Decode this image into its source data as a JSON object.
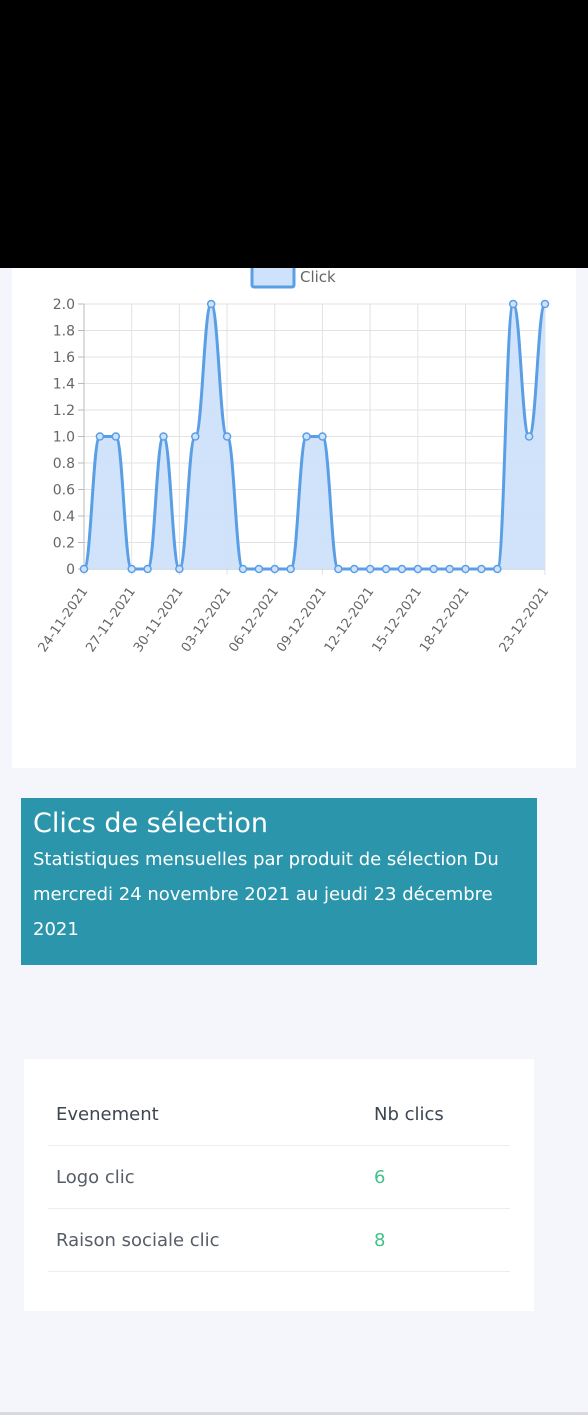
{
  "chart_data": {
    "type": "line",
    "legend": "Click",
    "x_tick_labels": [
      "24-11-2021",
      "27-11-2021",
      "30-11-2021",
      "03-12-2021",
      "06-12-2021",
      "09-12-2021",
      "12-12-2021",
      "15-12-2021",
      "18-12-2021",
      "23-12-2021"
    ],
    "y_ticks": [
      "0",
      "0.2",
      "0.4",
      "0.6",
      "0.8",
      "1.0",
      "1.2",
      "1.4",
      "1.6",
      "1.8",
      "2.0"
    ],
    "ylim": [
      0,
      2
    ],
    "x": [
      "24-11-2021",
      "25-11-2021",
      "26-11-2021",
      "27-11-2021",
      "28-11-2021",
      "29-11-2021",
      "30-11-2021",
      "01-12-2021",
      "02-12-2021",
      "03-12-2021",
      "04-12-2021",
      "05-12-2021",
      "06-12-2021",
      "07-12-2021",
      "08-12-2021",
      "09-12-2021",
      "10-12-2021",
      "11-12-2021",
      "12-12-2021",
      "13-12-2021",
      "14-12-2021",
      "15-12-2021",
      "16-12-2021",
      "17-12-2021",
      "18-12-2021",
      "19-12-2021",
      "20-12-2021",
      "21-12-2021",
      "22-12-2021",
      "23-12-2021"
    ],
    "values": [
      0,
      1,
      1,
      0,
      0,
      1,
      0,
      1,
      2,
      1,
      0,
      0,
      0,
      0,
      1,
      1,
      0,
      0,
      0,
      0,
      0,
      0,
      0,
      0,
      0,
      0,
      0,
      2,
      1,
      2
    ],
    "fill_color": "#cfe2fb",
    "line_color": "#5a9fe6",
    "grid": true
  },
  "section": {
    "title": "Clics de sélection",
    "subtitle_lines": [
      "Statistiques mensuelles par produit de sélection Du",
      "mercredi 24 novembre 2021 au jeudi 23 décembre",
      "2021"
    ]
  },
  "table": {
    "headers": [
      "Evenement",
      "Nb clics"
    ],
    "rows": [
      {
        "event": "Logo clic",
        "count": "6"
      },
      {
        "event": "Raison sociale clic",
        "count": "8"
      }
    ]
  },
  "colors": {
    "banner": "#2b96ab",
    "count_text": "#44c08a"
  }
}
